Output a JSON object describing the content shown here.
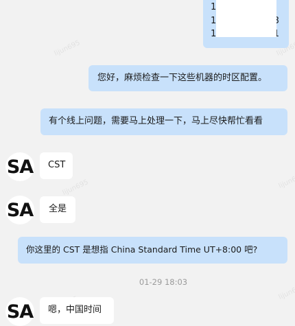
{
  "watermark": "lijun695",
  "redacted_message": {
    "lines": [
      "1",
      "1",
      "1"
    ],
    "line_tails": [
      "",
      "3",
      "1"
    ]
  },
  "messages": [
    {
      "id": "m1",
      "from": "me",
      "text": "您好，麻烦检查一下这些机器的时区配置。"
    },
    {
      "id": "m2",
      "from": "me",
      "text": "有个线上问题，需要马上处理一下，马上尽快帮忙看看"
    },
    {
      "id": "m3",
      "from": "them",
      "avatar": "SA",
      "text": "CST"
    },
    {
      "id": "m4",
      "from": "them",
      "avatar": "SA",
      "text": "全是"
    },
    {
      "id": "m5",
      "from": "me",
      "text": "你这里的 CST 是想指 China Standard Time UT+8:00 吧?"
    },
    {
      "id": "m6",
      "from": "them",
      "avatar": "SA",
      "text": "嗯，中国时间"
    }
  ],
  "timestamp": "01-29 18:03",
  "colors": {
    "background": "#f2f2f2",
    "my_bubble": "#c8e1fb",
    "their_bubble": "#ffffff",
    "timestamp_text": "#9a9a9a"
  }
}
